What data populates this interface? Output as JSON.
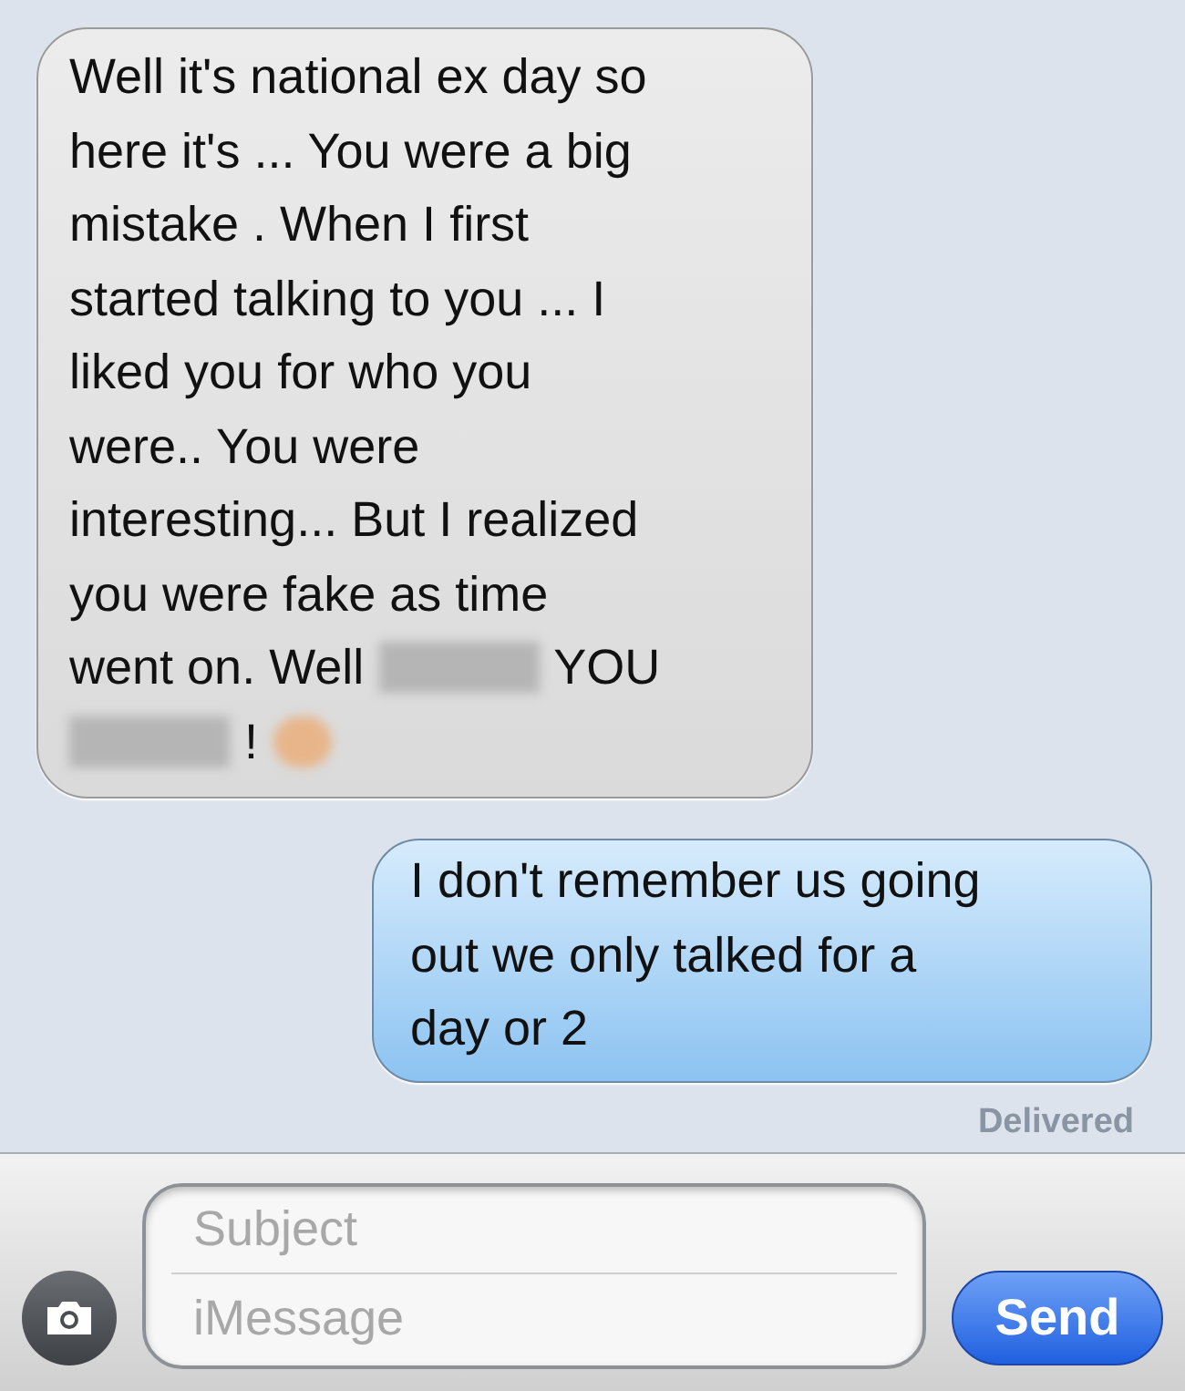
{
  "messages": [
    {
      "kind": "received",
      "lines": [
        [
          {
            "kind": "text",
            "text": "Well it's national ex day so"
          }
        ],
        [
          {
            "kind": "text",
            "text": "here it's ... You were a big"
          }
        ],
        [
          {
            "kind": "text",
            "text": "mistake . When I first"
          }
        ],
        [
          {
            "kind": "text",
            "text": "started talking to you ... I"
          }
        ],
        [
          {
            "kind": "text",
            "text": "liked you for who you"
          }
        ],
        [
          {
            "kind": "text",
            "text": "were.. You were"
          }
        ],
        [
          {
            "kind": "text",
            "text": "interesting... But I realized"
          }
        ],
        [
          {
            "kind": "text",
            "text": "you were fake as time"
          }
        ],
        [
          {
            "kind": "text",
            "text": "went on. Well"
          },
          {
            "kind": "redacted"
          },
          {
            "kind": "text",
            "text": "YOU"
          }
        ],
        [
          {
            "kind": "redacted"
          },
          {
            "kind": "text",
            "text": "!"
          },
          {
            "kind": "redacted_emoji"
          }
        ]
      ]
    },
    {
      "kind": "sent",
      "lines": [
        [
          {
            "kind": "text",
            "text": "I don't remember us going"
          }
        ],
        [
          {
            "kind": "text",
            "text": "out we only talked for a"
          }
        ],
        [
          {
            "kind": "text",
            "text": "day or 2"
          }
        ]
      ]
    }
  ],
  "status": "Delivered",
  "composer": {
    "subject_placeholder": "Subject",
    "message_placeholder": "iMessage",
    "send_label": "Send"
  }
}
